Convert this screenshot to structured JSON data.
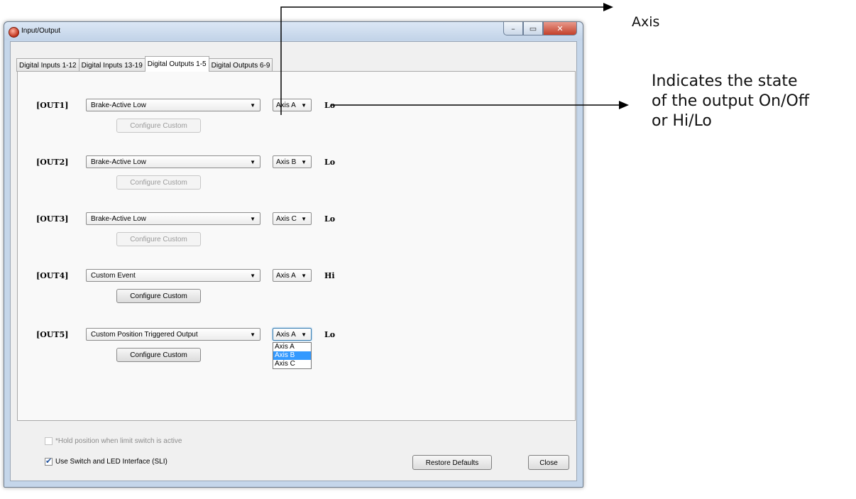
{
  "window": {
    "title": "Input/Output",
    "controls": {
      "minimize": "–",
      "maximize": "▭",
      "close": "✕"
    }
  },
  "tabs": [
    "Digital Inputs 1-12",
    "Digital Inputs 13-19",
    "Digital Outputs 1-5",
    "Digital Outputs 6-9"
  ],
  "active_tab": "Digital Outputs 1-5",
  "outputs": [
    {
      "label": "[OUT1]",
      "function": "Brake-Active Low",
      "axis": "Axis A",
      "state": "Lo",
      "configure": "Configure Custom",
      "configure_enabled": false
    },
    {
      "label": "[OUT2]",
      "function": "Brake-Active Low",
      "axis": "Axis B",
      "state": "Lo",
      "configure": "Configure Custom",
      "configure_enabled": false
    },
    {
      "label": "[OUT3]",
      "function": "Brake-Active Low",
      "axis": "Axis C",
      "state": "Lo",
      "configure": "Configure Custom",
      "configure_enabled": false
    },
    {
      "label": "[OUT4]",
      "function": "Custom Event",
      "axis": "Axis A",
      "state": "Hi",
      "configure": "Configure Custom",
      "configure_enabled": true
    },
    {
      "label": "[OUT5]",
      "function": "Custom Position Triggered Output",
      "axis": "Axis A",
      "state": "Lo",
      "configure": "Configure Custom",
      "configure_enabled": true
    }
  ],
  "axis_dropdown": {
    "options": [
      "Axis A",
      "Axis B",
      "Axis C"
    ],
    "highlighted": "Axis B"
  },
  "footer": {
    "hold_position": {
      "label": "*Hold position when limit switch is active",
      "checked": false,
      "enabled": false
    },
    "use_sli": {
      "label": "Use Switch and LED Interface (SLI)",
      "checked": true
    },
    "restore_defaults": "Restore Defaults",
    "close": "Close"
  },
  "annotations": {
    "axis": "Axis",
    "state_line1": "Indicates the state",
    "state_line2": "of the output On/Off",
    "state_line3": "or Hi/Lo"
  },
  "icons": {
    "app": "app-icon",
    "dropdown": "chevron-down-icon",
    "check": "checkmark-icon"
  }
}
